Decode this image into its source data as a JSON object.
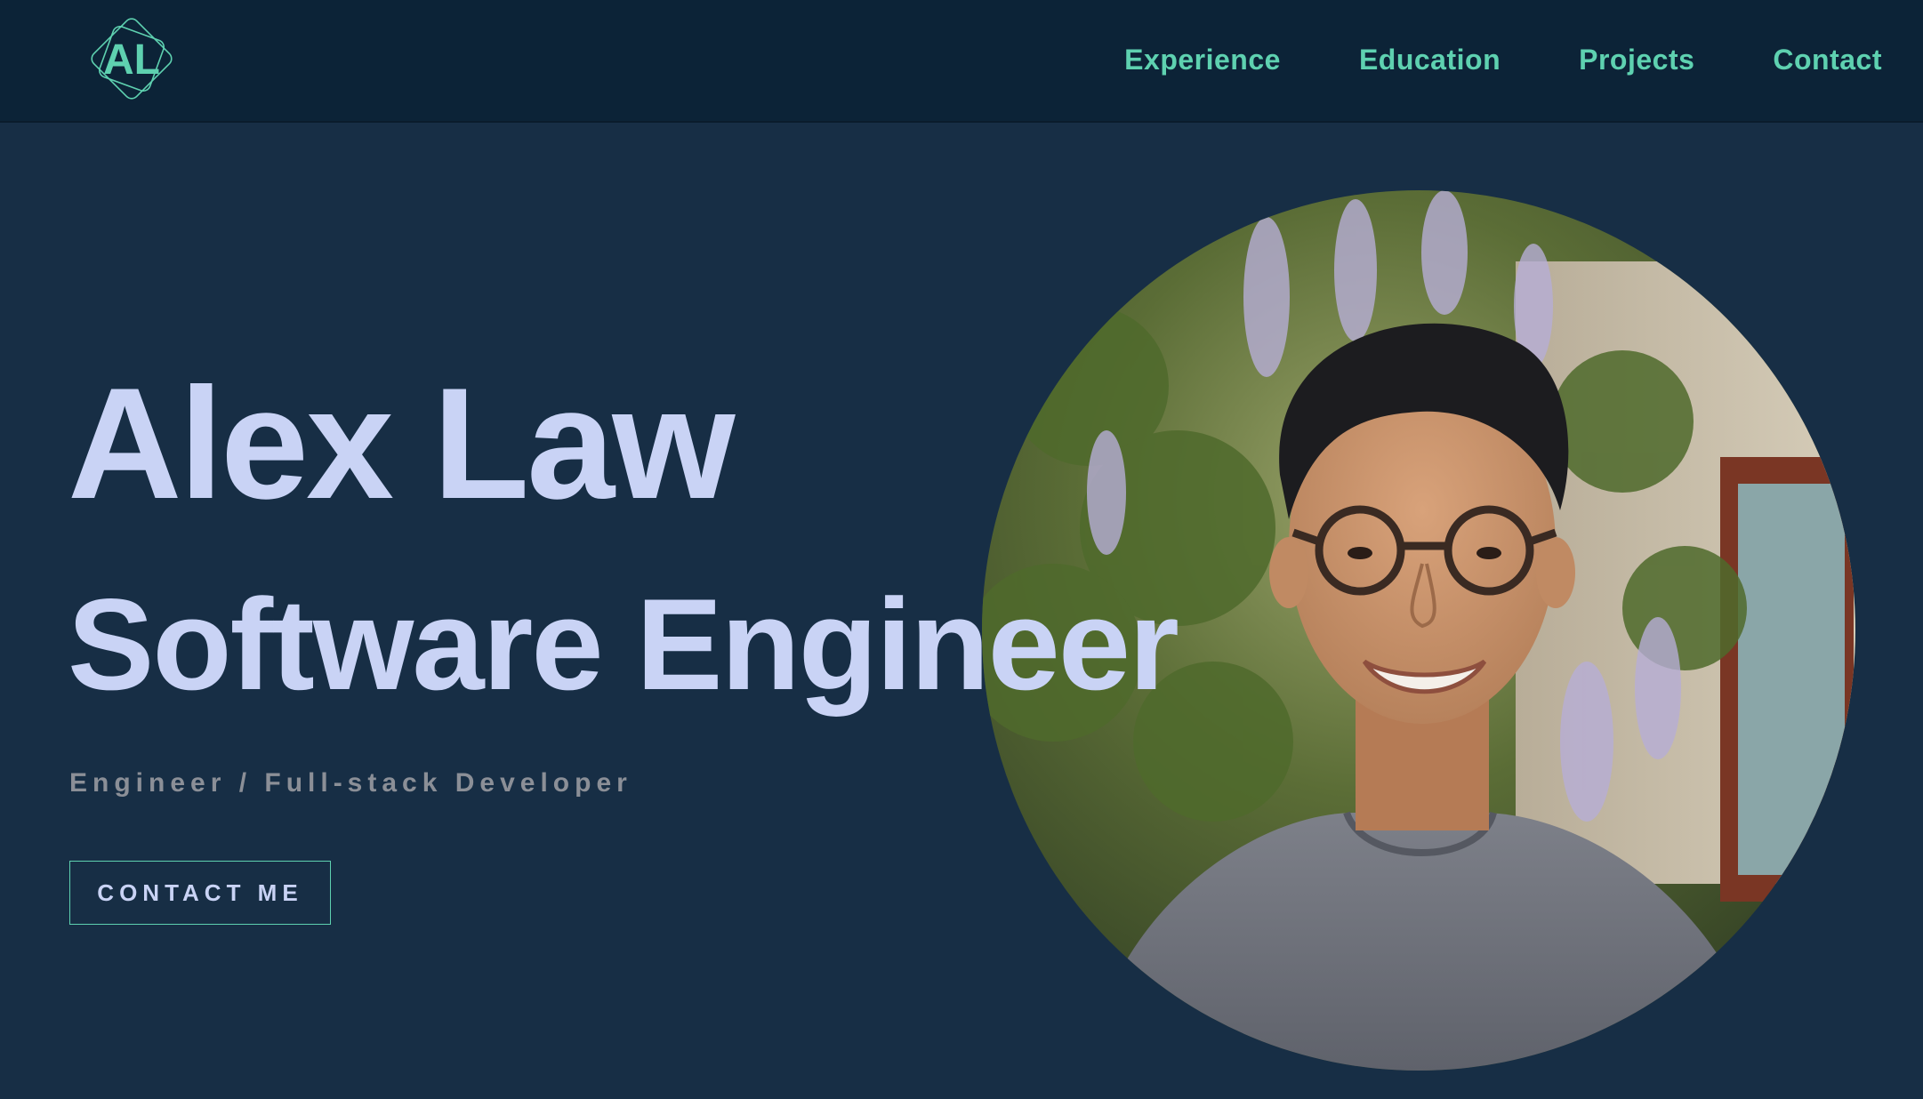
{
  "header": {
    "logo": {
      "text": "AL",
      "icon": "diamond-monogram-logo",
      "color": "#5ed1b0"
    },
    "nav": [
      {
        "label": "Experience"
      },
      {
        "label": "Education"
      },
      {
        "label": "Projects"
      },
      {
        "label": "Contact"
      }
    ]
  },
  "hero": {
    "name": "Alex Law",
    "role": "Software Engineer",
    "tagline": "Engineer / Full-stack Developer",
    "cta_label": "CONTACT ME",
    "portrait": {
      "description_icon": "profile-photo"
    }
  },
  "colors": {
    "background": "#172e45",
    "nav_background": "#0c2337",
    "accent": "#5ed1b0",
    "heading": "#c9d3f5",
    "muted": "#8b8f97"
  }
}
